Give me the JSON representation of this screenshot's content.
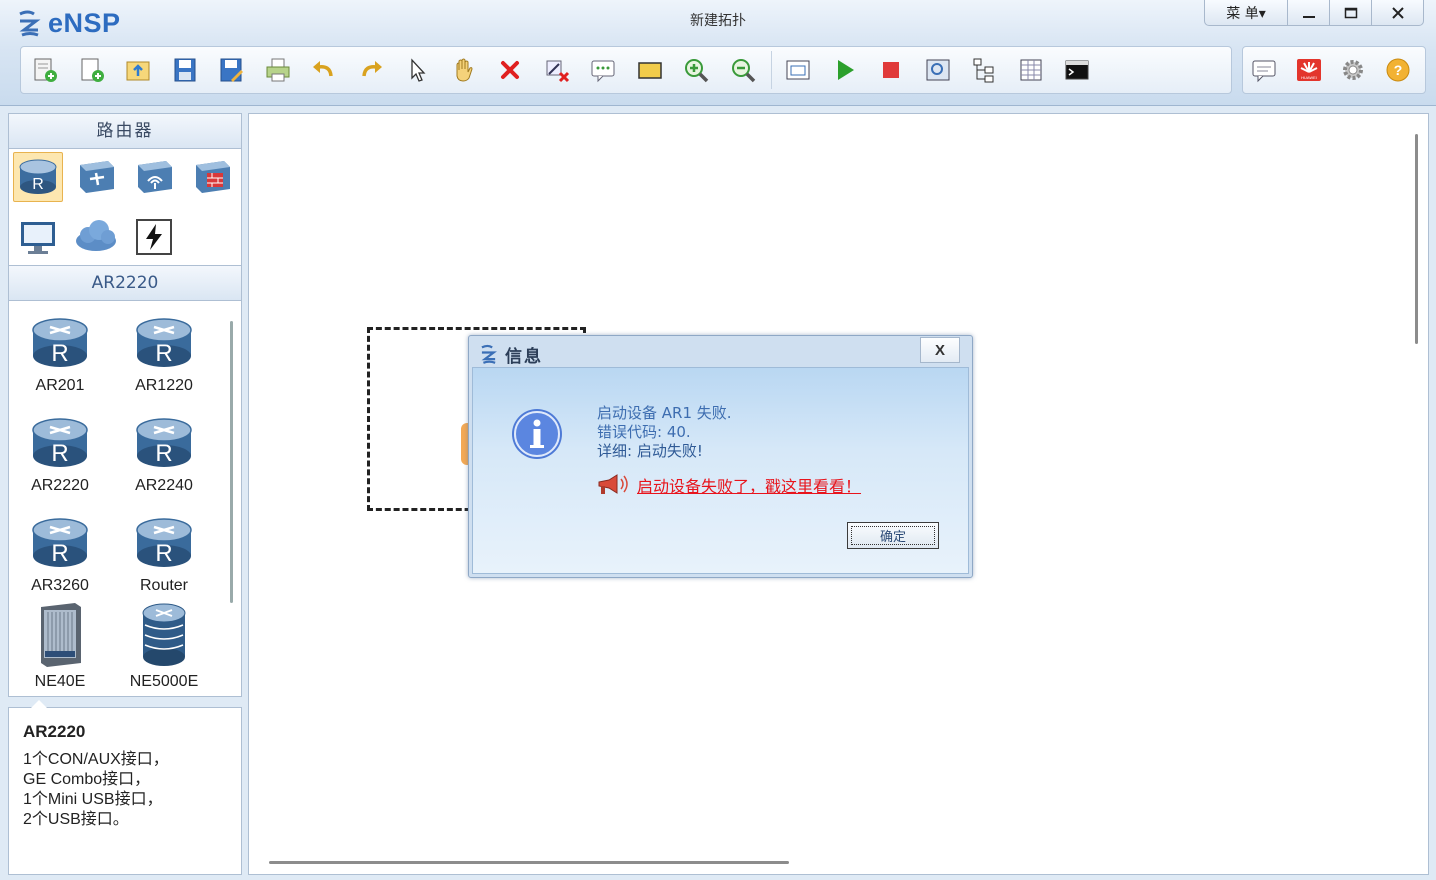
{
  "app": {
    "name": "eNSP",
    "window_title": "新建拓扑",
    "menu_label": "菜 单▾",
    "minimize": "—",
    "maximize": "☐",
    "close": "✕"
  },
  "toolbar": {
    "main_icons": [
      "new-topology",
      "new-lab",
      "open",
      "save",
      "save-as",
      "print",
      "undo",
      "redo",
      "select",
      "pan",
      "delete",
      "delete-link",
      "text-note",
      "rectangle",
      "zoom-in",
      "zoom-out",
      "fit",
      "start-all",
      "stop-all",
      "capture",
      "topology-tree",
      "grid",
      "terminal"
    ],
    "right_icons": [
      "chat",
      "huawei-logo",
      "settings",
      "help"
    ],
    "colors": {
      "start": "#2ca02c",
      "stop": "#e03a3a",
      "delete": "#e02020",
      "accent": "#2d6cc0"
    }
  },
  "sidebar": {
    "category_title": "路由器",
    "categories": [
      "router",
      "switch",
      "wireless",
      "firewall",
      "pc",
      "cloud",
      "link"
    ],
    "subcategory_title": "AR2220",
    "devices": [
      {
        "label": "AR201",
        "icon": "router"
      },
      {
        "label": "AR1220",
        "icon": "router"
      },
      {
        "label": "AR2220",
        "icon": "router"
      },
      {
        "label": "AR2240",
        "icon": "router"
      },
      {
        "label": "AR3260",
        "icon": "router"
      },
      {
        "label": "Router",
        "icon": "router"
      },
      {
        "label": "NE40E",
        "icon": "chassis"
      },
      {
        "label": "NE5000E",
        "icon": "core-router"
      }
    ],
    "description": {
      "title": "AR2220",
      "lines": [
        "1个CON/AUX接口，",
        "GE Combo接口，",
        "1个Mini USB接口，",
        "2个USB接口。"
      ]
    }
  },
  "dialog": {
    "title": "信息",
    "close_label": "X",
    "line1": "启动设备 AR1 失败.",
    "line2": "错误代码: 40.",
    "line3": "详细: 启动失败!",
    "help_link": "启动设备失败了，戳这里看看！",
    "ok_label": "确定"
  }
}
